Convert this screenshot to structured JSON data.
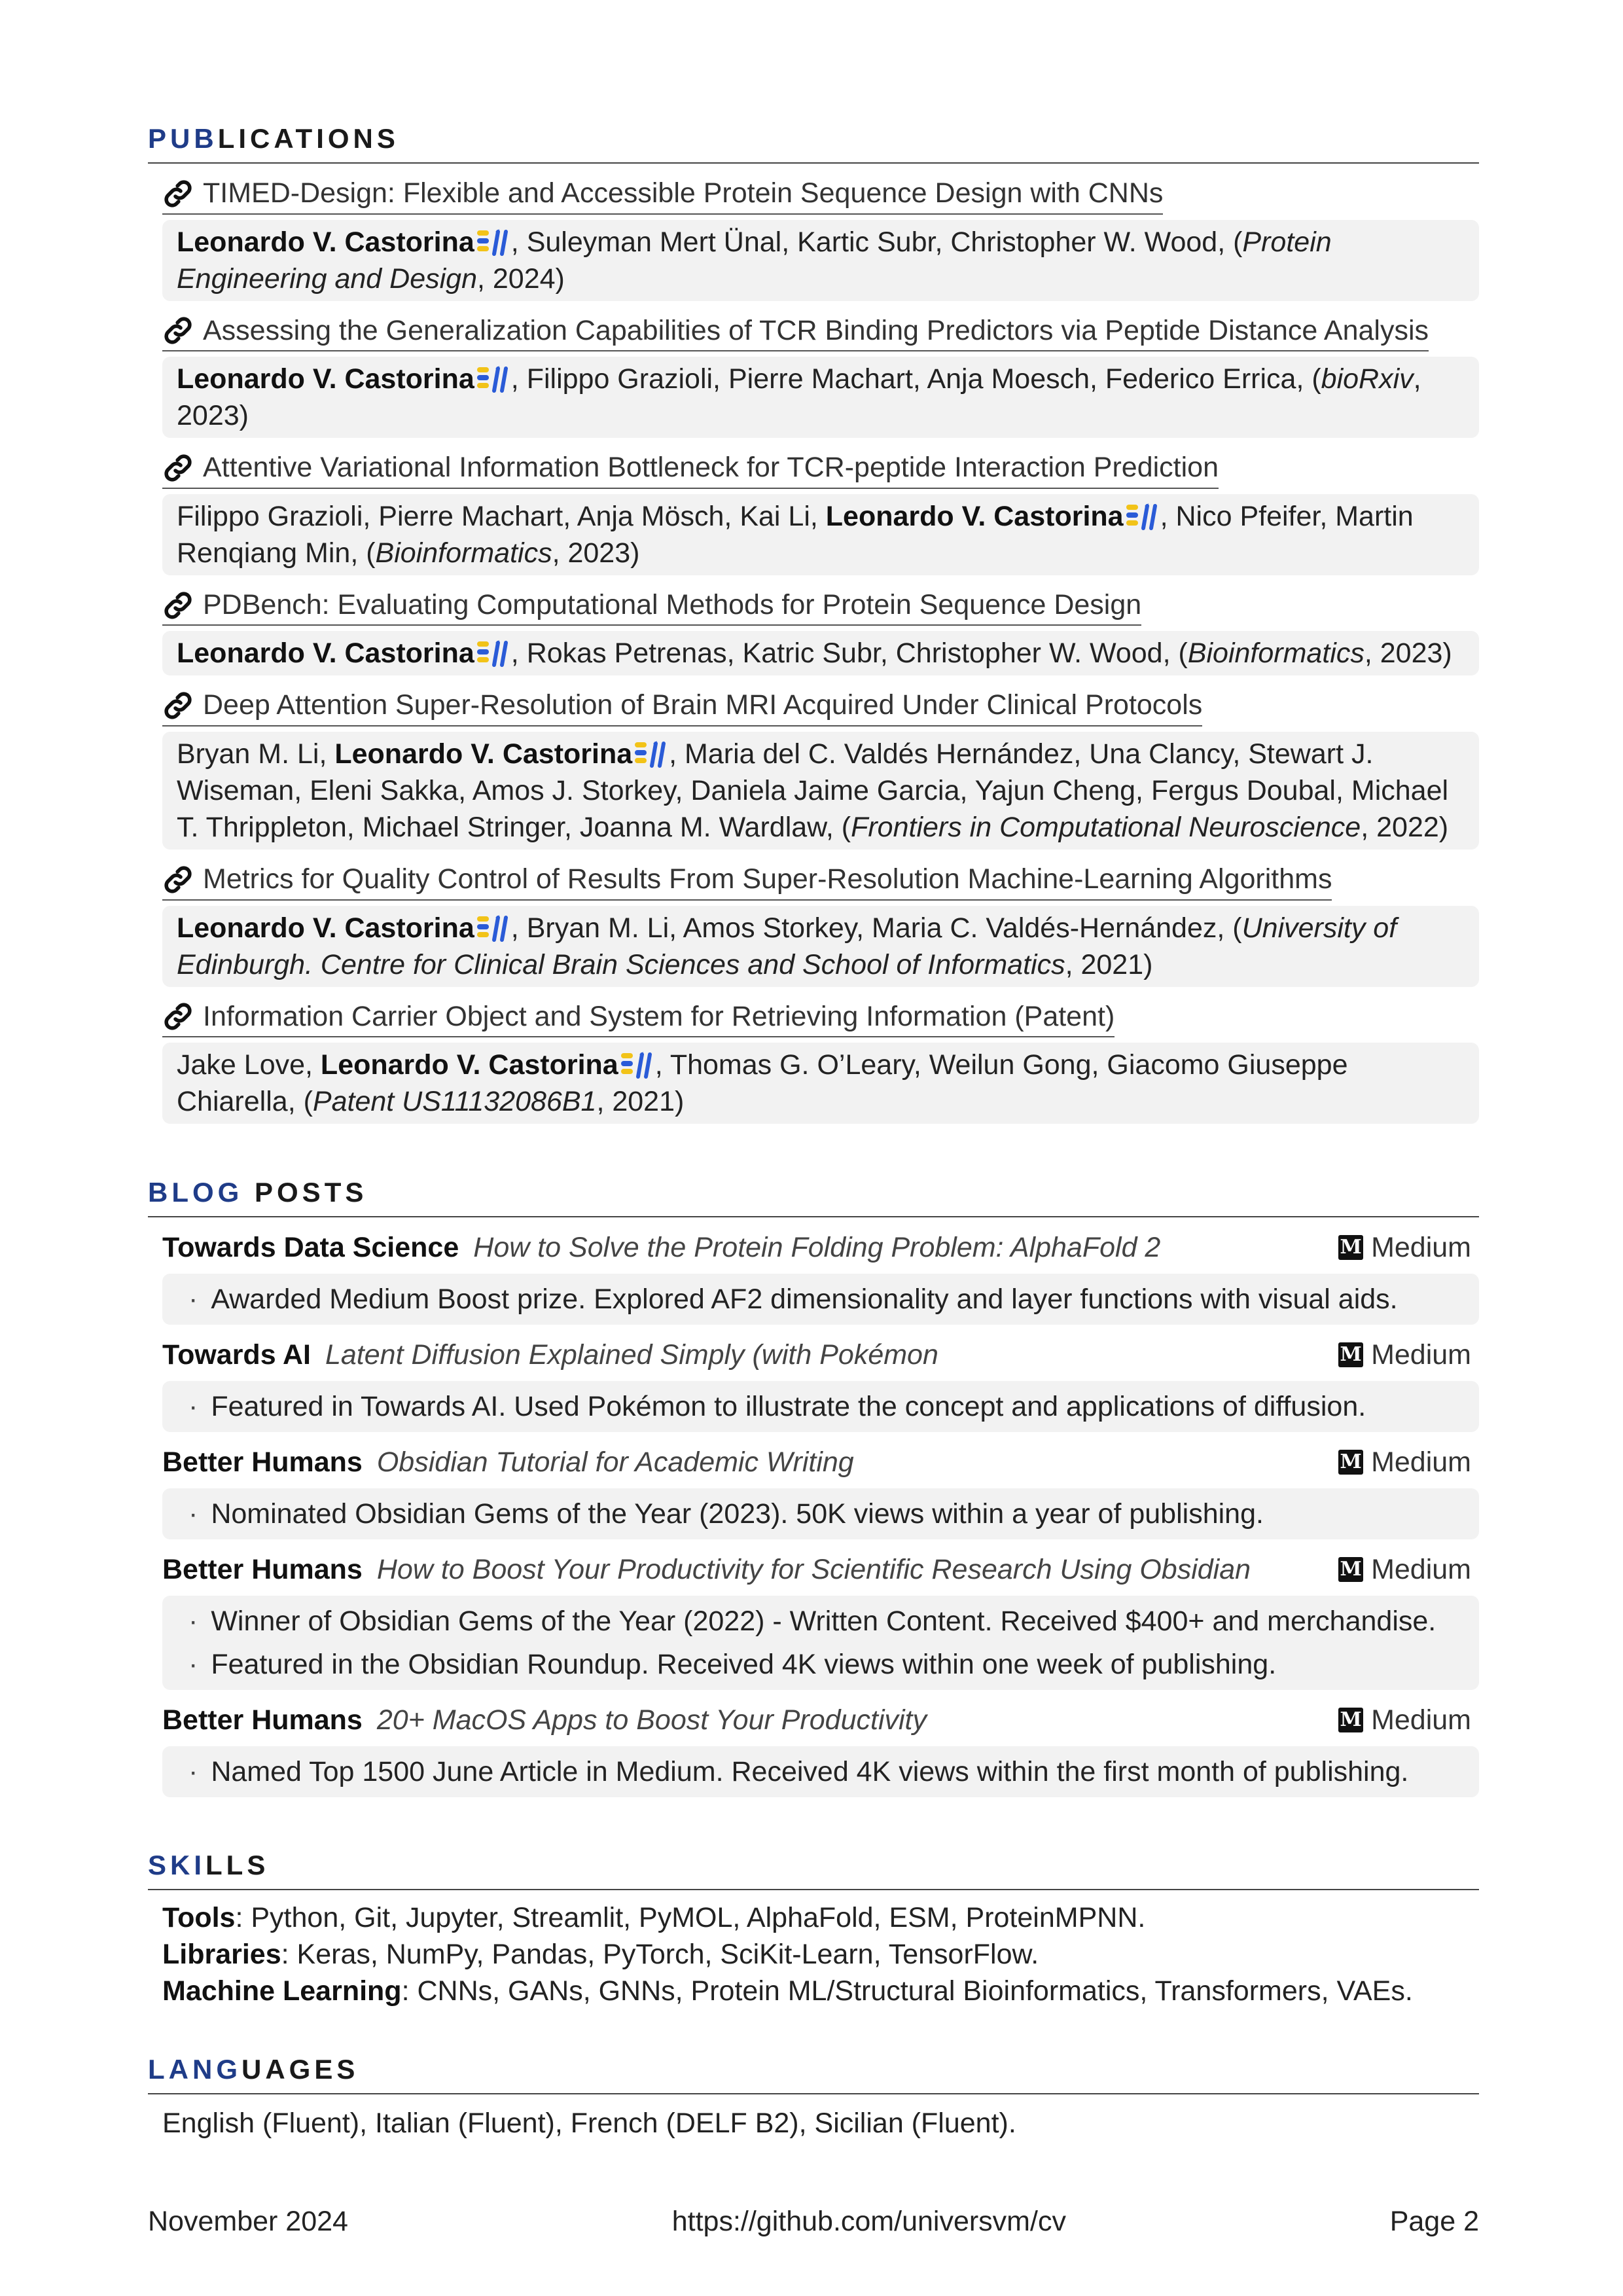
{
  "publications": {
    "title_accent": "PUB",
    "title_rest": "LICATIONS",
    "items": [
      {
        "title": "TIMED-Design: Flexible and Accessible Protein Sequence Design with CNNs",
        "before": "",
        "author": "Leonardo V. Castorina",
        "after": ", Suleyman Mert Ünal, Kartic Subr, Christopher W. Wood, (",
        "venue": "Protein Engineering and Design",
        "tail": ", 2024)"
      },
      {
        "title": "Assessing the Generalization Capabilities of TCR Binding Predictors via Peptide Distance Analysis",
        "before": "",
        "author": "Leonardo V. Castorina",
        "after": ", Filippo Grazioli, Pierre Machart, Anja Moesch, Federico Errica, (",
        "venue": "bioRxiv",
        "tail": ", 2023)"
      },
      {
        "title": "Attentive Variational Information Bottleneck for TCR-peptide Interaction Prediction",
        "before": "Filippo Grazioli, Pierre Machart, Anja Mösch, Kai Li, ",
        "author": "Leonardo V. Castorina",
        "after": ", Nico Pfeifer, Martin Renqiang Min, (",
        "venue": "Bioinformatics",
        "tail": ", 2023)"
      },
      {
        "title": "PDBench: Evaluating Computational Methods for Protein Sequence Design",
        "before": "",
        "author": "Leonardo V. Castorina",
        "after": ", Rokas Petrenas, Katric Subr, Christopher W. Wood, (",
        "venue": "Bioinformatics",
        "tail": ", 2023)"
      },
      {
        "title": "Deep Attention Super-Resolution of Brain MRI Acquired Under Clinical Protocols",
        "before": "Bryan M. Li, ",
        "author": "Leonardo V. Castorina",
        "after": ", Maria del C. Valdés Hernández, Una Clancy, Stewart J. Wiseman, Eleni Sakka, Amos J. Storkey, Daniela Jaime Garcia, Yajun Cheng, Fergus Doubal, Michael T. Thrippleton, Michael Stringer, Joanna M. Wardlaw, (",
        "venue": "Frontiers in Computational Neuroscience",
        "tail": ", 2022)"
      },
      {
        "title": "Metrics for Quality Control of Results From Super-Resolution Machine-Learning Algorithms",
        "before": "",
        "author": "Leonardo V. Castorina",
        "after": ", Bryan M. Li, Amos Storkey, Maria C. Valdés-Hernández, (",
        "venue": "University of Edinburgh. Centre for Clinical Brain Sciences and School of Informatics",
        "tail": ", 2021)"
      },
      {
        "title": "Information Carrier Object and System for Retrieving Information (Patent)",
        "before": "Jake Love, ",
        "author": "Leonardo V. Castorina",
        "after": ", Thomas G. O’Leary, Weilun Gong, Giacomo Giuseppe Chiarella, (",
        "venue": "Patent US11132086B1",
        "tail": ", 2021)"
      }
    ]
  },
  "blog": {
    "title_accent": "BLOG",
    "title_rest": " POSTS",
    "platform": "Medium",
    "items": [
      {
        "outlet": "Towards Data Science",
        "post": "How to Solve the Protein Folding Problem: AlphaFold 2",
        "bullets": [
          "Awarded Medium Boost prize. Explored AF2 dimensionality and layer functions with visual aids."
        ]
      },
      {
        "outlet": "Towards AI",
        "post": "Latent Diffusion Explained Simply (with Pokémon",
        "bullets": [
          "Featured in Towards AI. Used Pokémon to illustrate the concept and applications of diffusion."
        ]
      },
      {
        "outlet": "Better Humans",
        "post": "Obsidian Tutorial for Academic Writing",
        "bullets": [
          "Nominated Obsidian Gems of the Year (2023). 50K views within a year of publishing."
        ]
      },
      {
        "outlet": "Better Humans",
        "post": "How to Boost Your Productivity for Scientific Research Using Obsidian",
        "bullets": [
          "Winner of Obsidian Gems of the Year (2022) - Written Content. Received $400+ and merchandise.",
          "Featured in the Obsidian Roundup. Received 4K views within one week of publishing."
        ]
      },
      {
        "outlet": "Better Humans",
        "post": "20+ MacOS Apps to Boost Your Productivity",
        "bullets": [
          "Named Top 1500 June Article in Medium. Received 4K views within the first month of publishing."
        ]
      }
    ]
  },
  "skills": {
    "title_accent": "SKI",
    "title_rest": "LLS",
    "rows": [
      {
        "label": "Tools",
        "value": ": Python, Git, Jupyter, Streamlit, PyMOL, AlphaFold, ESM, ProteinMPNN."
      },
      {
        "label": "Libraries",
        "value": ": Keras, NumPy, Pandas, PyTorch, SciKit-Learn, TensorFlow."
      },
      {
        "label": "Machine Learning",
        "value": ": CNNs, GANs, GNNs, Protein ML/Structural Bioinformatics, Transformers, VAEs."
      }
    ]
  },
  "languages": {
    "title_accent": "LANG",
    "title_rest": "UAGES",
    "text": "English (Fluent), Italian (Fluent), French (DELF B2), Sicilian (Fluent)."
  },
  "footer": {
    "date": "November 2024",
    "url": "https://github.com/universvm/cv",
    "page": "Page 2"
  },
  "colors": {
    "accent": "#1f3c88",
    "panel": "#f2f2f2",
    "hf_yellow": "#f2c318",
    "hf_blue": "#2a5bd7"
  },
  "icons": {
    "link": "link-icon",
    "author_badge": "huggingface-badge-icon",
    "medium": "medium-icon"
  }
}
